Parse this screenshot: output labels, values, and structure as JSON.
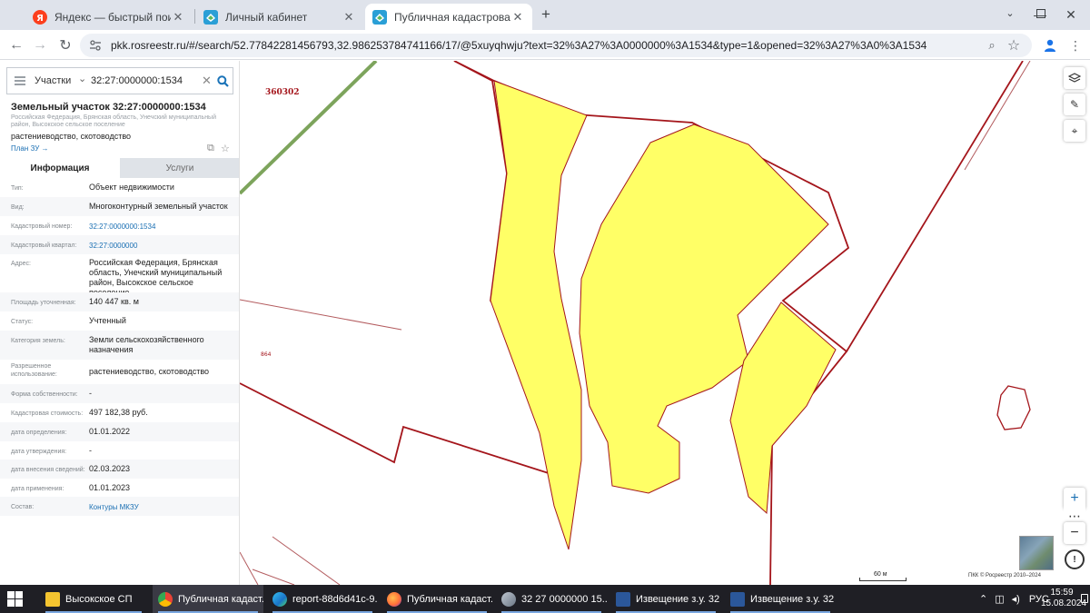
{
  "browser": {
    "tabs": [
      {
        "title": "Яндекс — быстрый поиск в ин",
        "icon": "yandex-icon",
        "active": false
      },
      {
        "title": "Личный кабинет",
        "icon": "rosreestr-icon",
        "active": false
      },
      {
        "title": "Публичная кадастровая карта",
        "icon": "rosreestr-icon",
        "active": true
      }
    ],
    "new_tab": "+",
    "url": "pkk.rosreestr.ru/#/search/52.77842281456793,32.986253784741166/17/@5xuyqhwju?text=32%3A27%3A0000000%3A1534&type=1&opened=32%3A27%3A0%3A1534"
  },
  "search": {
    "type_label": "Участки",
    "query": "32:27:0000000:1534"
  },
  "object": {
    "title": "Земельный участок 32:27:0000000:1534",
    "address_short": "Российская Федерация, Брянская область, Унечский муниципальный район, Высокское сельское поселение",
    "use": "растениеводство, скотоводство",
    "plan_link": "План ЗУ →"
  },
  "panel_tabs": {
    "info": "Информация",
    "services": "Услуги"
  },
  "properties": [
    {
      "label": "Тип:",
      "value": "Объект недвижимости",
      "link": false
    },
    {
      "label": "Вид:",
      "value": "Многоконтурный земельный участок",
      "link": false
    },
    {
      "label": "Кадастровый номер:",
      "value": "32:27:0000000:1534",
      "link": true
    },
    {
      "label": "Кадастровый квартал:",
      "value": "32:27:0000000",
      "link": true
    },
    {
      "label": "Адрес:",
      "value": "Российская Федерация, Брянская область, Унечский муниципальный район, Высокское сельское поселение",
      "link": false
    },
    {
      "label": "Площадь уточненная:",
      "value": "140 447 кв. м",
      "link": false
    },
    {
      "label": "Статус:",
      "value": "Учтенный",
      "link": false
    },
    {
      "label": "Категория земель:",
      "value": "Земли сельскохозяйственного назначения",
      "link": false
    },
    {
      "label": "Разрешенное использование:",
      "value": "растениеводство, скотоводство",
      "link": false
    },
    {
      "label": "Форма собственности:",
      "value": "-",
      "link": false
    },
    {
      "label": "Кадастровая стоимость:",
      "value": "497 182,38 руб.",
      "link": false
    },
    {
      "label": "дата определения:",
      "value": "01.01.2022",
      "link": false
    },
    {
      "label": "дата утверждения:",
      "value": "-",
      "link": false
    },
    {
      "label": "дата внесения сведений:",
      "value": "02.03.2023",
      "link": false
    },
    {
      "label": "дата применения:",
      "value": "01.01.2023",
      "link": false
    },
    {
      "label": "Состав:",
      "value": "Контуры МКЗУ",
      "link": true
    }
  ],
  "map": {
    "label_block": "360302",
    "label_parcel": "864",
    "scale": "60 м",
    "copyright": "ПКК © Росреестр 2010–2024",
    "colors": {
      "parcel_fill": "#ffff66",
      "boundary": "#a4151b",
      "road": "#7da45c"
    }
  },
  "taskbar": {
    "items": [
      {
        "label": "Высокское СП",
        "icon": "folder-icon"
      },
      {
        "label": "Публичная кадаст...",
        "icon": "chrome-icon",
        "active": true
      },
      {
        "label": "report-88d6d41c-9...",
        "icon": "edge-icon"
      },
      {
        "label": "Публичная кадаст...",
        "icon": "firefox-icon"
      },
      {
        "label": "32 27 0000000 15...",
        "icon": "viewer-icon"
      },
      {
        "label": "Извещение з.у. 32 ...",
        "icon": "word-icon"
      },
      {
        "label": "Извещение з.у. 32 ...",
        "icon": "word-icon"
      }
    ],
    "lang": "РУС",
    "time": "15:59",
    "date": "15.08.2024"
  }
}
